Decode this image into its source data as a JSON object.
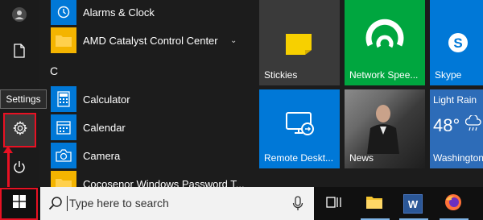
{
  "tooltip": "Settings",
  "app_list": {
    "items": [
      {
        "label": "Alarms & Clock"
      },
      {
        "label": "AMD Catalyst Control Center",
        "chevron": "⌄"
      },
      {
        "label": "Calculator"
      },
      {
        "label": "Calendar"
      },
      {
        "label": "Camera"
      },
      {
        "label": "Cocosenor Windows Password T..."
      }
    ],
    "section_letter": "C"
  },
  "tiles": {
    "stickies": {
      "label": "Stickies",
      "color": "#f2f2f2"
    },
    "network": {
      "label": "Network Spee...",
      "color": "#00a63f"
    },
    "skype": {
      "label": "Skype",
      "color": "#0078d7"
    },
    "remote": {
      "label": "Remote Deskt...",
      "color": "#0078d7"
    },
    "news": {
      "label": "News"
    },
    "weather": {
      "condition": "Light Rain",
      "temp": "48°",
      "location": "Washington"
    }
  },
  "taskbar": {
    "search_placeholder": "Type here to search",
    "word_letter": "W"
  },
  "colors": {
    "accent": "#0078d7",
    "highlight": "#e81123"
  }
}
